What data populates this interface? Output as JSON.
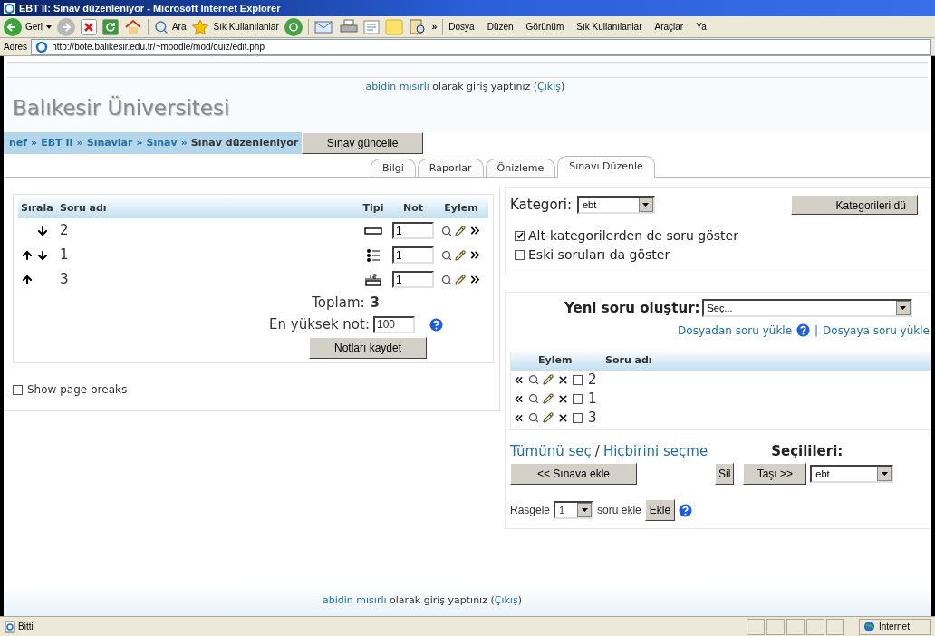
{
  "window": {
    "title": "EBT II: Sınav düzenleniyor - Microsoft Internet Explorer"
  },
  "toolbar": {
    "back": "Geri",
    "search": "Ara",
    "favorites": "Sık Kullanılanlar",
    "chevron": "»",
    "menu": [
      "Dosya",
      "Düzen",
      "Görünüm",
      "Sık Kullanılanlar",
      "Araçlar",
      "Ya"
    ]
  },
  "address": {
    "label": "Adres",
    "url": "http://bote.balikesir.edu.tr/~moodle/mod/quiz/edit.php"
  },
  "header": {
    "site": "Balıkesir Üniversitesi",
    "login": {
      "user": "abidin mısırlı",
      "text": " olarak giriş yaptınız (",
      "logout": "Çıkış",
      "end": ")"
    }
  },
  "breadcrumb": [
    {
      "kind": "link",
      "label": "nef"
    },
    {
      "kind": "separator",
      "label": "»"
    },
    {
      "kind": "link",
      "label": "EBT II"
    },
    {
      "kind": "separator",
      "label": "»"
    },
    {
      "kind": "link",
      "label": "Sınavlar"
    },
    {
      "kind": "separator",
      "label": "»"
    },
    {
      "kind": "link",
      "label": "Sınav"
    },
    {
      "kind": "separator",
      "label": "»"
    },
    {
      "kind": "current",
      "label": "Sınav düzenleniyor"
    }
  ],
  "update_button": "Sınav güncelle",
  "tabs": [
    {
      "label": "Bilgi",
      "selected": false
    },
    {
      "label": "Raporlar",
      "selected": false
    },
    {
      "label": "Önizleme",
      "selected": false
    },
    {
      "label": "Sınavı Düzenle",
      "selected": true
    }
  ],
  "quiz": {
    "columns": [
      "Sırala",
      "Soru adı",
      "Tipi",
      "Not",
      "Eylem"
    ],
    "rows": [
      {
        "up": false,
        "down": true,
        "name": "2",
        "kind": "shortanswer",
        "grade": "1"
      },
      {
        "up": true,
        "down": true,
        "name": "1",
        "kind": "multichoice",
        "grade": "1"
      },
      {
        "up": true,
        "down": false,
        "name": "3",
        "kind": "numerical",
        "grade": "1"
      }
    ],
    "total_label": "Toplam:",
    "total": "3",
    "max_label": "En yüksek not:",
    "max": "100",
    "save": "Notları kaydet"
  },
  "page_breaks": {
    "label": "Show page breaks",
    "checked": false
  },
  "category": {
    "label": "Kategori:",
    "value": "ebt",
    "edit_button": "Kategorileri dü",
    "options": [
      {
        "label": "Alt-kategorilerden de soru göster",
        "checked": true
      },
      {
        "label": "Eski soruları da göster",
        "checked": false
      }
    ]
  },
  "bank": {
    "new_label": "Yeni soru oluştur:",
    "new_value": "Seç...",
    "import": "Dosyadan soru yükle",
    "divider": "|",
    "export": "Dosyaya soru yükle",
    "columns": [
      "Eylem",
      "Soru adı"
    ],
    "rows": [
      {
        "name": "2",
        "checked": false
      },
      {
        "name": "1",
        "checked": false
      },
      {
        "name": "3",
        "checked": false
      }
    ],
    "select_all": "Tümünü seç",
    "slash": "/",
    "select_none": "Hiçbirini seçme",
    "selected_label": "Seçilileri:",
    "add": "<< Sınava ekle",
    "delete": "Sil",
    "move": "Taşı >>",
    "move_target": "ebt",
    "random_label": "Rasgele",
    "random_count": "1",
    "random_suffix": "soru ekle",
    "random_add": "Ekle"
  },
  "footer": {
    "login": {
      "user": "abidin mısırlı",
      "text": " olarak giriş yaptınız (",
      "logout": "Çıkış",
      "end": ")"
    }
  },
  "status": {
    "text": "Bitti",
    "zone": "Internet"
  }
}
